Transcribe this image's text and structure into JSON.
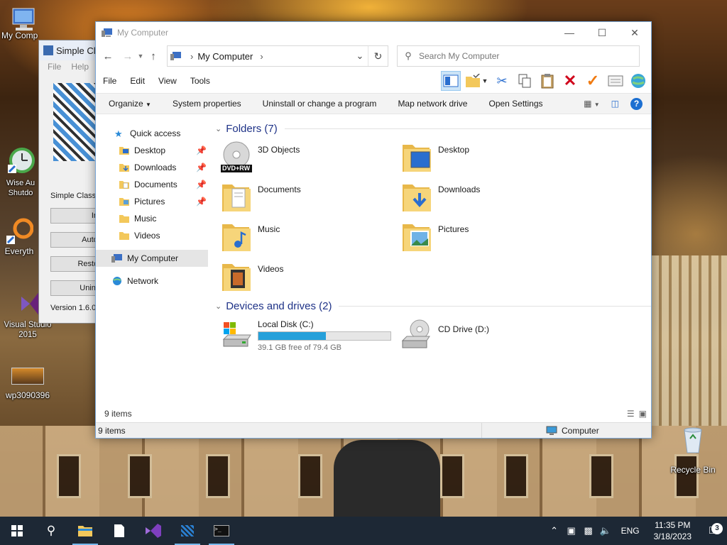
{
  "desktop": {
    "icons": [
      {
        "label": "My Comp"
      },
      {
        "label": "Wise Au\nShutdo"
      },
      {
        "label": "Everyth"
      },
      {
        "label": "Visual Studio\n2015"
      },
      {
        "label": "wp3090396"
      },
      {
        "label": "Recycle Bin"
      }
    ]
  },
  "simple_window": {
    "title": "Simple Cl",
    "menu": [
      "File",
      "Help"
    ],
    "label": "Simple Classic",
    "buttons": [
      "In",
      "Auto-lo",
      "Restore",
      "Uninstal"
    ],
    "version": "Version 1.6.0"
  },
  "explorer": {
    "title": "My Computer",
    "breadcrumb": "My Computer",
    "search_placeholder": "Search My Computer",
    "menu": [
      "File",
      "Edit",
      "View",
      "Tools"
    ],
    "commands": [
      "Organize",
      "System properties",
      "Uninstall or change a program",
      "Map network drive",
      "Open Settings"
    ],
    "nav": {
      "quick_access": "Quick access",
      "pinned": [
        "Desktop",
        "Downloads",
        "Documents",
        "Pictures"
      ],
      "unpinned": [
        "Music",
        "Videos"
      ],
      "this_pc": "My Computer",
      "network": "Network"
    },
    "folders_header": "Folders (7)",
    "folders": [
      "3D Objects",
      "Desktop",
      "Documents",
      "Downloads",
      "Music",
      "Pictures",
      "Videos"
    ],
    "dvd_label": "DVD+RW",
    "drives_header": "Devices and drives (2)",
    "drives": [
      {
        "name": "Local Disk (C:)",
        "free": "39.1 GB free of 79.4 GB",
        "used_fraction": 0.51
      },
      {
        "name": "CD Drive (D:)"
      }
    ],
    "status_items": "9 items",
    "status_bar_items": "9 items",
    "status_zone": "Computer"
  },
  "taskbar": {
    "lang": "ENG",
    "time": "11:35 PM",
    "date": "3/18/2023",
    "notification_count": "3"
  },
  "colors": {
    "accent": "#26a0da",
    "taskbar": "#1d2835",
    "group_header": "#1e3287"
  }
}
